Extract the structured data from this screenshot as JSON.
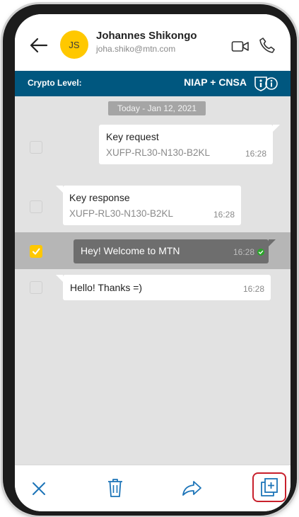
{
  "header": {
    "avatar_initials": "JS",
    "contact_name": "Johannes Shikongo",
    "contact_email": "joha.shiko@mtn.com"
  },
  "crypto": {
    "label": "Crypto Level:",
    "value": "NIAP + CNSA"
  },
  "chat": {
    "date_separator": "Today - Jan 12, 2021",
    "messages": [
      {
        "direction": "outgoing",
        "title": "Key request",
        "subtitle": "XUFP-RL30-N130-B2KL",
        "time": "16:28",
        "selected": false
      },
      {
        "direction": "incoming",
        "title": "Key response",
        "subtitle": "XUFP-RL30-N130-B2KL",
        "time": "16:28",
        "selected": false
      },
      {
        "direction": "outgoing",
        "title": "Hey! Welcome to MTN",
        "time": "16:28",
        "selected": true,
        "delivered": true
      },
      {
        "direction": "incoming",
        "title": "Hello! Thanks =)",
        "time": "16:28",
        "selected": false
      }
    ]
  },
  "bottom_bar": {
    "icons": [
      "close-icon",
      "trash-icon",
      "forward-icon",
      "copy-icon"
    ],
    "highlighted": "copy-icon"
  },
  "colors": {
    "accent": "#ffc800",
    "crypto_bar": "#00577f",
    "icon_blue": "#1c74b8",
    "highlight": "#c8202c",
    "delivered": "#2aa52a"
  }
}
